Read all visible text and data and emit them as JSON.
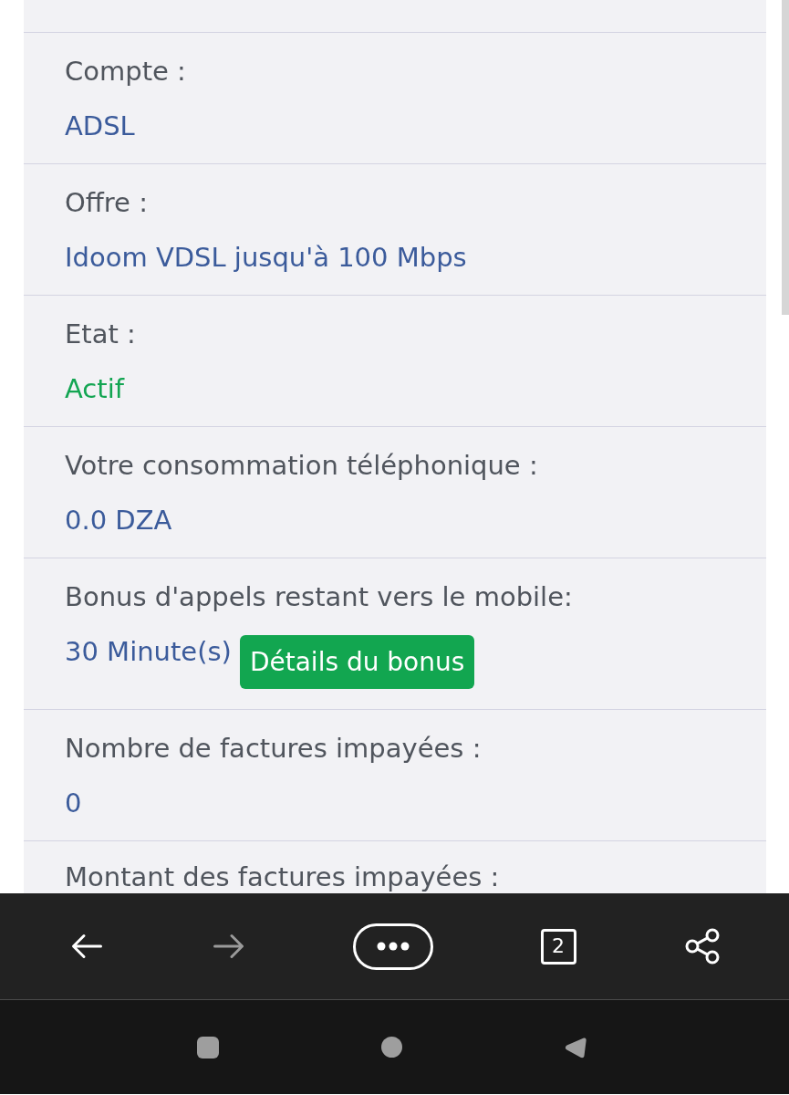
{
  "fields": [
    {
      "kind": "text",
      "label": "Compte :",
      "value": "ADSL"
    },
    {
      "kind": "text",
      "label": "Offre :",
      "value": "Idoom VDSL jusqu'à 100 Mbps"
    },
    {
      "kind": "status",
      "label": "Etat :",
      "value": "Actif"
    },
    {
      "kind": "text",
      "label": "Votre consommation téléphonique :",
      "value": "0.0 DZA"
    },
    {
      "kind": "bonus",
      "label": "Bonus d'appels restant vers le mobile:",
      "value": "30 Minute(s)",
      "button": "Détails du bonus"
    },
    {
      "kind": "text",
      "label": "Nombre de factures impayées :",
      "value": "0"
    },
    {
      "kind": "partial",
      "label": "Montant des factures impayées :"
    }
  ],
  "browser_toolbar": {
    "forward_disabled": true,
    "tab_count": "2"
  }
}
